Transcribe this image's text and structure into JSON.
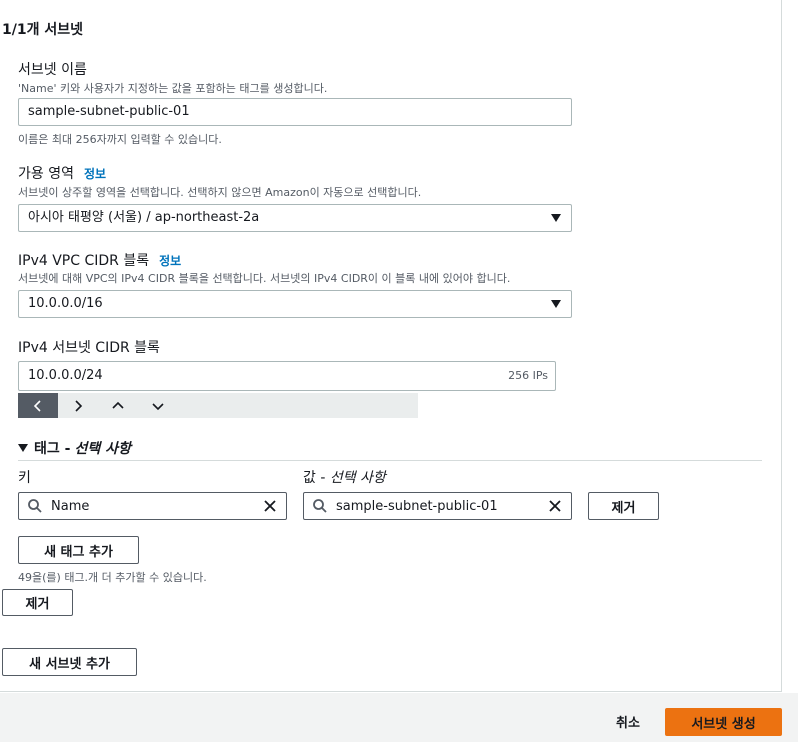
{
  "header": {
    "subnet_count": "1/1개 서브넷"
  },
  "subnet_name": {
    "label": "서브넷 이름",
    "description": "'Name' 키와 사용자가 지정하는 값을 포함하는 태그를 생성합니다.",
    "value": "sample-subnet-public-01",
    "constraint": "이름은 최대 256자까지 입력할 수 있습니다."
  },
  "availability_zone": {
    "label": "가용 영역",
    "info": "정보",
    "description": "서브넷이 상주할 영역을 선택합니다. 선택하지 않으면 Amazon이 자동으로 선택합니다.",
    "value": "아시아 태평양 (서울) / ap-northeast-2a"
  },
  "vpc_cidr": {
    "label": "IPv4 VPC CIDR 블록",
    "info": "정보",
    "description": "서브넷에 대해 VPC의 IPv4 CIDR 블록을 선택합니다. 서브넷의 IPv4 CIDR이 이 블록 내에 있어야 합니다.",
    "value": "10.0.0.0/16"
  },
  "subnet_cidr": {
    "label": "IPv4 서브넷 CIDR 블록",
    "value": "10.0.0.0/24",
    "ip_count": "256 IPs"
  },
  "tags": {
    "section_title": "태그 - ",
    "section_title_optional": "선택 사항",
    "key_label": "키",
    "value_label_prefix": "값 - ",
    "value_label_optional": "선택 사항",
    "key_value": "Name",
    "value_value": "sample-subnet-public-01",
    "remove_tag_label": "제거",
    "add_tag_label": "새 태그 추가",
    "remaining_note": "49을(를) 태그.개 더 추가할 수 있습니다."
  },
  "actions": {
    "remove_subnet_label": "제거",
    "add_subnet_label": "새 서브넷 추가",
    "cancel_label": "취소",
    "create_label": "서브넷 생성"
  },
  "colors": {
    "primary_button": "#ec7211",
    "info_link": "#0073bb",
    "footer_bg": "#f2f3f3"
  },
  "icons": {
    "stepper": [
      "chevron-left-icon",
      "chevron-right-icon",
      "chevron-up-icon",
      "chevron-down-icon"
    ]
  }
}
